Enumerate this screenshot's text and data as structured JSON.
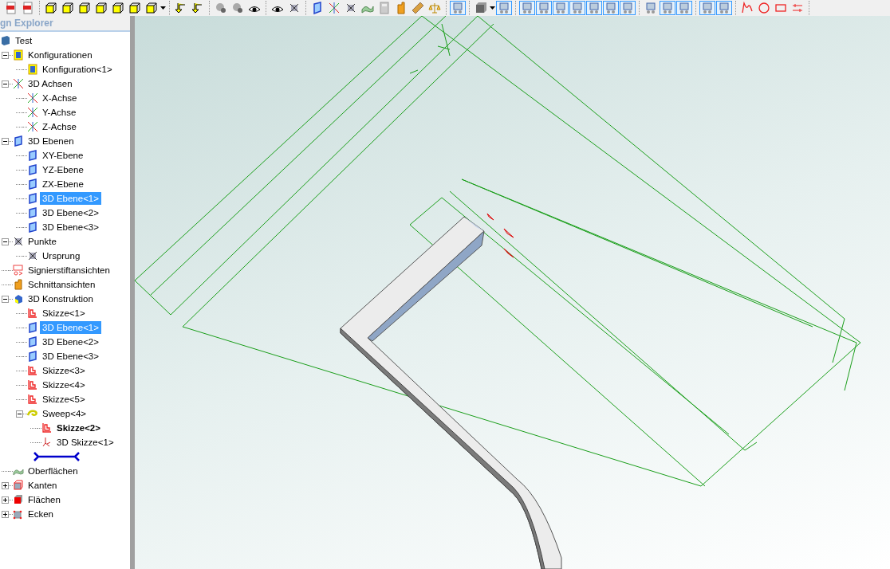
{
  "toolbar": {
    "groups": [
      [
        {
          "kind": "pdf",
          "selected": false
        },
        {
          "kind": "pdf",
          "selected": false
        }
      ],
      [
        {
          "kind": "cube",
          "selected": false
        },
        {
          "kind": "cube",
          "selected": false
        },
        {
          "kind": "cube",
          "selected": false
        },
        {
          "kind": "cube",
          "selected": false
        },
        {
          "kind": "cube",
          "selected": false
        },
        {
          "kind": "cube",
          "selected": false
        },
        {
          "kind": "cube",
          "selected": false
        },
        {
          "kind": "caret"
        }
      ],
      [
        {
          "kind": "arrow",
          "selected": false
        },
        {
          "kind": "arrow",
          "selected": false
        }
      ],
      [
        {
          "kind": "render",
          "selected": false
        },
        {
          "kind": "render",
          "selected": false
        },
        {
          "kind": "eye",
          "selected": false
        }
      ],
      [
        {
          "kind": "eye",
          "selected": false
        },
        {
          "kind": "point",
          "selected": false
        }
      ],
      [
        {
          "kind": "plane",
          "selected": false
        },
        {
          "kind": "axis",
          "selected": false
        },
        {
          "kind": "point",
          "selected": false
        },
        {
          "kind": "surface",
          "selected": false
        },
        {
          "kind": "calc",
          "selected": false
        },
        {
          "kind": "section",
          "selected": false
        },
        {
          "kind": "ruler",
          "selected": false
        },
        {
          "kind": "scale",
          "selected": false
        }
      ],
      [
        {
          "kind": "tool",
          "selected": true
        }
      ],
      [
        {
          "kind": "box",
          "selected": false
        },
        {
          "kind": "caret"
        },
        {
          "kind": "tool",
          "selected": true
        }
      ],
      [
        {
          "kind": "tool",
          "selected": true
        },
        {
          "kind": "tool",
          "selected": true
        },
        {
          "kind": "tool",
          "selected": true
        },
        {
          "kind": "tool",
          "selected": true
        },
        {
          "kind": "tool",
          "selected": true
        },
        {
          "kind": "tool",
          "selected": true
        },
        {
          "kind": "tool",
          "selected": true
        }
      ],
      [
        {
          "kind": "tool",
          "selected": false
        },
        {
          "kind": "tool",
          "selected": true
        },
        {
          "kind": "tool",
          "selected": true
        }
      ],
      [
        {
          "kind": "tool",
          "selected": true
        },
        {
          "kind": "tool",
          "selected": true
        }
      ],
      [
        {
          "kind": "spline",
          "selected": false
        },
        {
          "kind": "circle",
          "selected": false
        },
        {
          "kind": "rect",
          "selected": false
        },
        {
          "kind": "text",
          "selected": false
        }
      ]
    ]
  },
  "panel": {
    "title": "gn Explorer"
  },
  "tree": [
    {
      "label": "Test",
      "kind": "root",
      "selected": false,
      "bold": false,
      "children": [
        {
          "label": "Konfigurationen",
          "kind": "config",
          "expanded": true,
          "selected": false,
          "bold": false,
          "children": [
            {
              "label": "Konfiguration<1>",
              "kind": "config",
              "selected": false,
              "bold": false
            }
          ]
        },
        {
          "label": "3D Achsen",
          "kind": "axis",
          "expanded": true,
          "selected": false,
          "bold": false,
          "children": [
            {
              "label": "X-Achse",
              "kind": "axis",
              "selected": false,
              "bold": false
            },
            {
              "label": "Y-Achse",
              "kind": "axis",
              "selected": false,
              "bold": false
            },
            {
              "label": "Z-Achse",
              "kind": "axis",
              "selected": false,
              "bold": false
            }
          ]
        },
        {
          "label": "3D Ebenen",
          "kind": "plane",
          "expanded": true,
          "selected": false,
          "bold": false,
          "children": [
            {
              "label": "XY-Ebene",
              "kind": "plane",
              "selected": false,
              "bold": false
            },
            {
              "label": "YZ-Ebene",
              "kind": "plane",
              "selected": false,
              "bold": false
            },
            {
              "label": "ZX-Ebene",
              "kind": "plane",
              "selected": false,
              "bold": false
            },
            {
              "label": "3D Ebene<1>",
              "kind": "plane",
              "selected": true,
              "bold": false
            },
            {
              "label": "3D Ebene<2>",
              "kind": "plane",
              "selected": false,
              "bold": false
            },
            {
              "label": "3D Ebene<3>",
              "kind": "plane",
              "selected": false,
              "bold": false
            }
          ]
        },
        {
          "label": "Punkte",
          "kind": "point",
          "expanded": true,
          "selected": false,
          "bold": false,
          "children": [
            {
              "label": "Ursprung",
              "kind": "point",
              "selected": false,
              "bold": false
            }
          ]
        },
        {
          "label": "Signierstiftansichten",
          "kind": "markup",
          "selected": false,
          "bold": false
        },
        {
          "label": "Schnittansichten",
          "kind": "section",
          "selected": false,
          "bold": false
        },
        {
          "label": "3D Konstruktion",
          "kind": "solid",
          "expanded": true,
          "selected": false,
          "bold": false,
          "children": [
            {
              "label": "Skizze<1>",
              "kind": "sketch",
              "selected": false,
              "bold": false
            },
            {
              "label": "3D Ebene<1>",
              "kind": "plane",
              "selected": true,
              "bold": false
            },
            {
              "label": "3D Ebene<2>",
              "kind": "plane",
              "selected": false,
              "bold": false
            },
            {
              "label": "3D Ebene<3>",
              "kind": "plane",
              "selected": false,
              "bold": false
            },
            {
              "label": "Skizze<3>",
              "kind": "sketch",
              "selected": false,
              "bold": false
            },
            {
              "label": "Skizze<4>",
              "kind": "sketch",
              "selected": false,
              "bold": false
            },
            {
              "label": "Skizze<5>",
              "kind": "sketch",
              "selected": false,
              "bold": false
            },
            {
              "label": "Sweep<4>",
              "kind": "sweep",
              "expanded": true,
              "selected": false,
              "bold": false,
              "children": [
                {
                  "label": "Skizze<2>",
                  "kind": "sketch",
                  "selected": false,
                  "bold": true
                },
                {
                  "label": "3D Skizze<1>",
                  "kind": "sketch3d",
                  "selected": false,
                  "bold": false
                }
              ]
            },
            {
              "kind": "marker"
            }
          ]
        },
        {
          "label": "Oberflächen",
          "kind": "surface",
          "selected": false,
          "bold": false
        },
        {
          "label": "Kanten",
          "kind": "edges",
          "expanded": false,
          "selected": false,
          "bold": false
        },
        {
          "label": "Flächen",
          "kind": "faces",
          "expanded": false,
          "selected": false,
          "bold": false
        },
        {
          "label": "Ecken",
          "kind": "corners",
          "expanded": false,
          "selected": false,
          "bold": false
        }
      ]
    }
  ]
}
